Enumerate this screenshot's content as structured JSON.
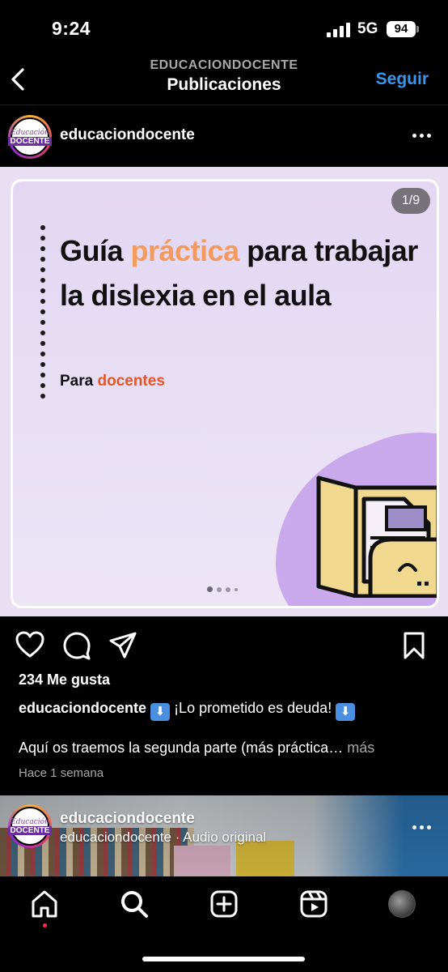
{
  "status_bar": {
    "time": "9:24",
    "network": "5G",
    "battery": "94"
  },
  "header": {
    "account": "EDUCACIONDOCENTE",
    "title": "Publicaciones",
    "follow_label": "Seguir"
  },
  "post": {
    "username": "educaciondocente",
    "avatar_text_top": "Educación",
    "avatar_text_bottom": "DOCENTE",
    "slide_counter": "1/9",
    "slide_title_part1": "Guía ",
    "slide_title_accent": "práctica",
    "slide_title_part2": " para trabajar la dislexia en el aula",
    "slide_subtitle_part1": "Para ",
    "slide_subtitle_accent": "docentes",
    "likes": "234 Me gusta",
    "caption_user": "educaciondocente",
    "caption_emoji": "⬇",
    "caption_text": " ¡Lo prometido es deuda! ",
    "caption_second_line": "Aquí os traemos la segunda parte (más práctica… ",
    "caption_more": "más",
    "timestamp": "Hace 1 semana",
    "colors": {
      "accent_orange": "#f39a5c",
      "accent_red": "#e0562a",
      "follow_blue": "#3897f0",
      "slide_bg": "#e3d7f3",
      "blob": "#c9a8ec"
    }
  },
  "next_post": {
    "username": "educaciondocente",
    "subtitle": "educaciondocente · Audio original"
  },
  "tab_bar": {
    "items": [
      "home-icon",
      "search-icon",
      "create-icon",
      "reels-icon",
      "profile-avatar"
    ]
  }
}
